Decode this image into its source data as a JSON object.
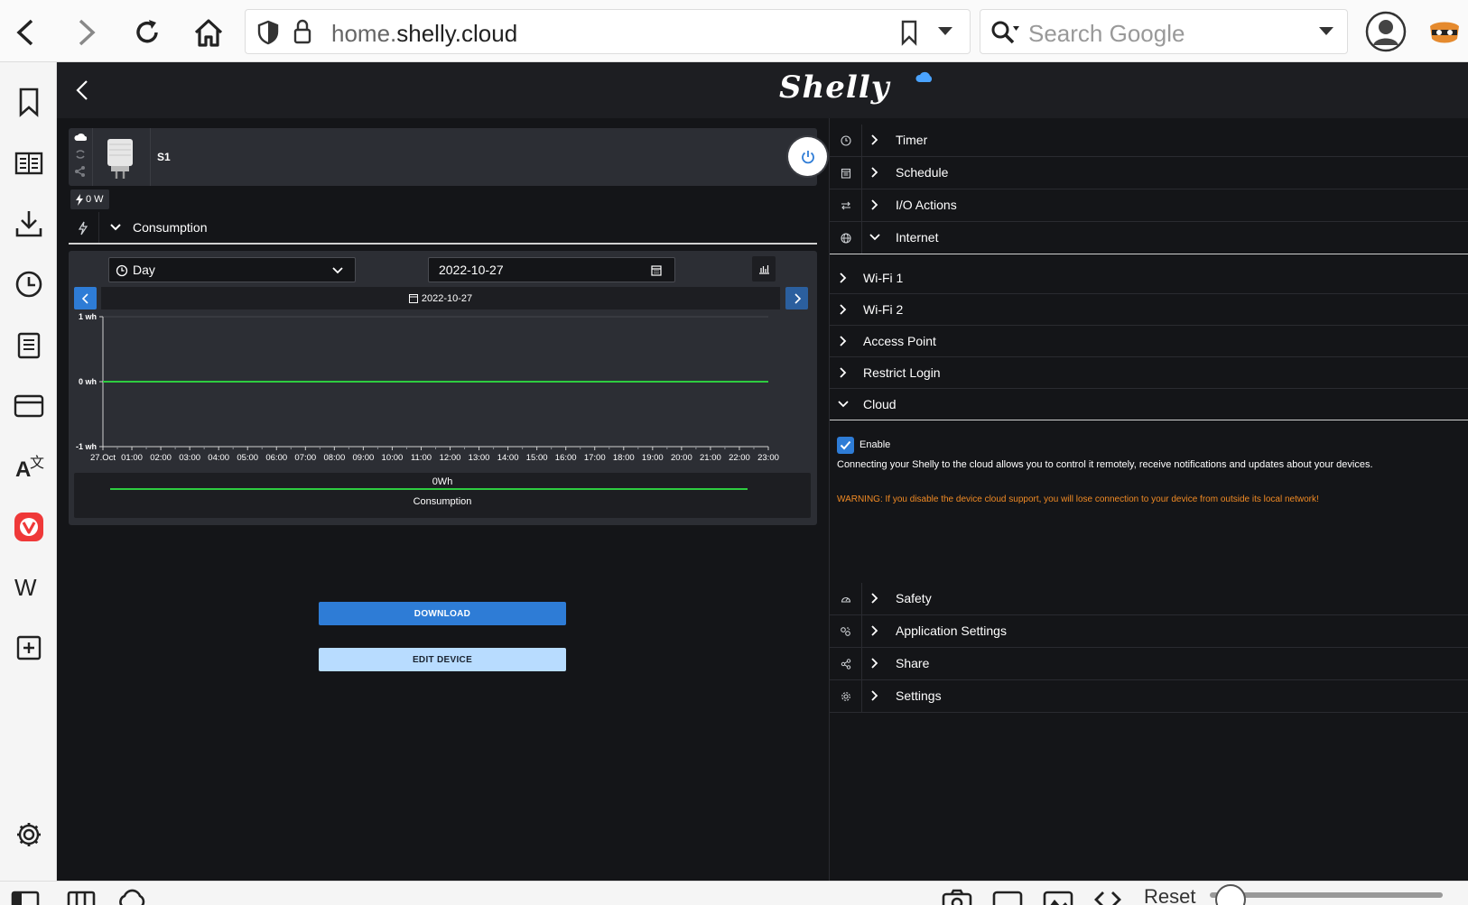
{
  "browser": {
    "url_prefix": "home.",
    "url_domain": "shelly.cloud",
    "search_placeholder": "Search Google"
  },
  "statusbar": {
    "reset_label": "Reset"
  },
  "app": {
    "logo_text": "Shelly",
    "device": {
      "name": "S1",
      "power_readout": "0 W"
    },
    "consumption_label": "Consumption",
    "period_select": "Day",
    "date_value": "2022-10-27",
    "date_strip": "2022-10-27",
    "buttons": {
      "download": "DOWNLOAD",
      "edit_device": "EDIT DEVICE"
    }
  },
  "chart_data": {
    "type": "line",
    "x": [
      "27.Oct",
      "01:00",
      "02:00",
      "03:00",
      "04:00",
      "05:00",
      "06:00",
      "07:00",
      "08:00",
      "09:00",
      "10:00",
      "11:00",
      "12:00",
      "13:00",
      "14:00",
      "15:00",
      "16:00",
      "17:00",
      "18:00",
      "19:00",
      "20:00",
      "21:00",
      "22:00",
      "23:00"
    ],
    "series": [
      {
        "name": "Consumption",
        "values": [
          0,
          0,
          0,
          0,
          0,
          0,
          0,
          0,
          0,
          0,
          0,
          0,
          0,
          0,
          0,
          0,
          0,
          0,
          0,
          0,
          0,
          0,
          0,
          0
        ],
        "color": "#2ecc40"
      }
    ],
    "yticks": [
      "1 wh",
      "0 wh",
      "-1 wh"
    ],
    "ylim": [
      -1,
      1
    ],
    "legend_total": "0Wh",
    "legend_name": "Consumption"
  },
  "menu": {
    "top": [
      {
        "label": "Timer",
        "icon": "clock-icon",
        "expanded": false
      },
      {
        "label": "Schedule",
        "icon": "calendar-icon",
        "expanded": false
      },
      {
        "label": "I/O Actions",
        "icon": "swap-icon",
        "expanded": false
      },
      {
        "label": "Internet",
        "icon": "globe-icon",
        "expanded": true
      }
    ],
    "internet_items": [
      {
        "label": "Wi-Fi 1"
      },
      {
        "label": "Wi-Fi 2"
      },
      {
        "label": "Access Point"
      },
      {
        "label": "Restrict Login"
      },
      {
        "label": "Cloud"
      }
    ],
    "cloud": {
      "enable_label": "Enable",
      "enabled": true,
      "description": "Connecting your Shelly to the cloud allows you to control it remotely, receive notifications and updates about your devices.",
      "warning": "WARNING: If you disable the device cloud support, you will lose connection to your device from outside its local network!"
    },
    "bottom": [
      {
        "label": "Safety",
        "icon": "gauge-icon"
      },
      {
        "label": "Application Settings",
        "icon": "app-settings-icon"
      },
      {
        "label": "Share",
        "icon": "share-icon"
      },
      {
        "label": "Settings",
        "icon": "gear-icon"
      }
    ]
  },
  "colors": {
    "accent": "#2e7cd6",
    "line": "#2ecc40",
    "warning": "#f08a24",
    "background": "#141518"
  }
}
